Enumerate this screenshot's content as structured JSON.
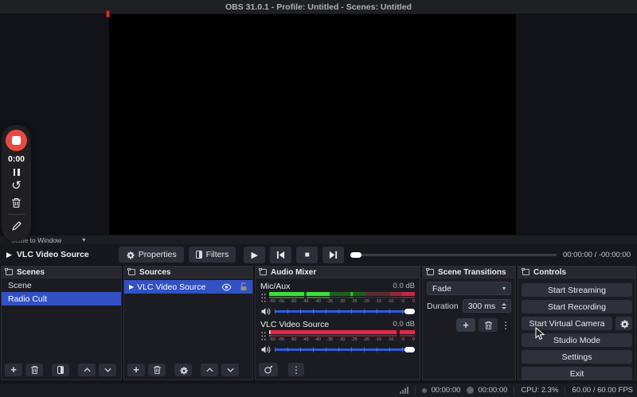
{
  "title_bar": {
    "title": "OBS 31.0.1 - Profile: Untitled - Scenes: Untitled"
  },
  "recorder": {
    "time": "0:00"
  },
  "preview": {
    "scale_option": "Scale to Window"
  },
  "media_controls": {
    "source": "VLC Video Source",
    "properties": "Properties",
    "filters": "Filters",
    "timecode": "00:00:00 / -00:00:00"
  },
  "scenes": {
    "title": "Scenes",
    "items": [
      "Scene",
      "Radio Cult"
    ]
  },
  "sources": {
    "title": "Sources",
    "items": [
      "VLC Video Source"
    ]
  },
  "audio_mixer": {
    "title": "Audio Mixer",
    "ticks": [
      "-60",
      "-55",
      "-50",
      "-45",
      "-40",
      "-35",
      "-30",
      "-25",
      "-20",
      "-15",
      "-10",
      "-5",
      "0"
    ],
    "channels": [
      {
        "name": "Mic/Aux",
        "level": "0.0 dB"
      },
      {
        "name": "VLC Video Source",
        "level": "0.0 dB"
      }
    ]
  },
  "scene_transitions": {
    "title": "Scene Transitions",
    "transition": "Fade",
    "duration_label": "Duration",
    "duration_value": "300 ms"
  },
  "controls": {
    "title": "Controls",
    "buttons": [
      "Start Streaming",
      "Start Recording",
      "Start Virtual Camera",
      "Studio Mode",
      "Settings",
      "Exit"
    ]
  },
  "status_bar": {
    "stream_time": "00:00:00",
    "record_time": "00:00:00",
    "cpu": "CPU: 2.3%",
    "fps": "60.00 / 60.00 FPS"
  },
  "icons": {
    "play": "▶",
    "stop": "■",
    "plus": "+",
    "dots_vertical": "⋮",
    "chevron_down": "▾",
    "restart": "↺"
  },
  "colors": {
    "accent_blue": "#3351c5",
    "record_red": "#e84a41",
    "meter_green": "#3ae03a",
    "meter_red": "#e2294b",
    "slider_blue": "#2e5be0"
  }
}
